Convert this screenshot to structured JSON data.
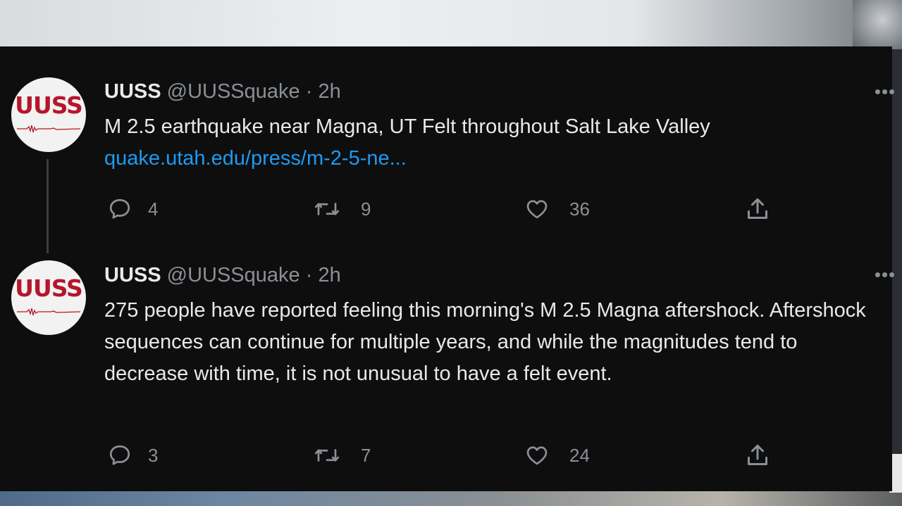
{
  "tweets": [
    {
      "avatar_text": "UUSS",
      "name": "UUSS",
      "handle": "@UUSSquake",
      "separator": " · ",
      "time": "2h",
      "more": "•••",
      "text": "M 2.5 earthquake near Magna, UT Felt throughout Salt Lake Valley",
      "link": "quake.utah.edu/press/m-2-5-ne...",
      "reply_count": "4",
      "retweet_count": "9",
      "like_count": "36"
    },
    {
      "avatar_text": "UUSS",
      "name": "UUSS",
      "handle": "@UUSSquake",
      "separator": " · ",
      "time": "2h",
      "more": "•••",
      "text": "275 people have reported feeling this morning's M 2.5 Magna aftershock. Aftershock sequences can continue for multiple years, and while the magnitudes tend to decrease with time, it is not unusual to have a felt event.",
      "reply_count": "3",
      "retweet_count": "7",
      "like_count": "24"
    }
  ],
  "icons": {
    "reply": "reply-icon",
    "retweet": "retweet-icon",
    "like": "heart-icon",
    "share": "share-icon",
    "more": "more-icon"
  },
  "colors": {
    "panel_bg": "#0e0e0f",
    "text_primary": "#e7e9ea",
    "text_secondary": "#8b9096",
    "link": "#1d9bf0",
    "avatar_brand": "#b5162b"
  }
}
